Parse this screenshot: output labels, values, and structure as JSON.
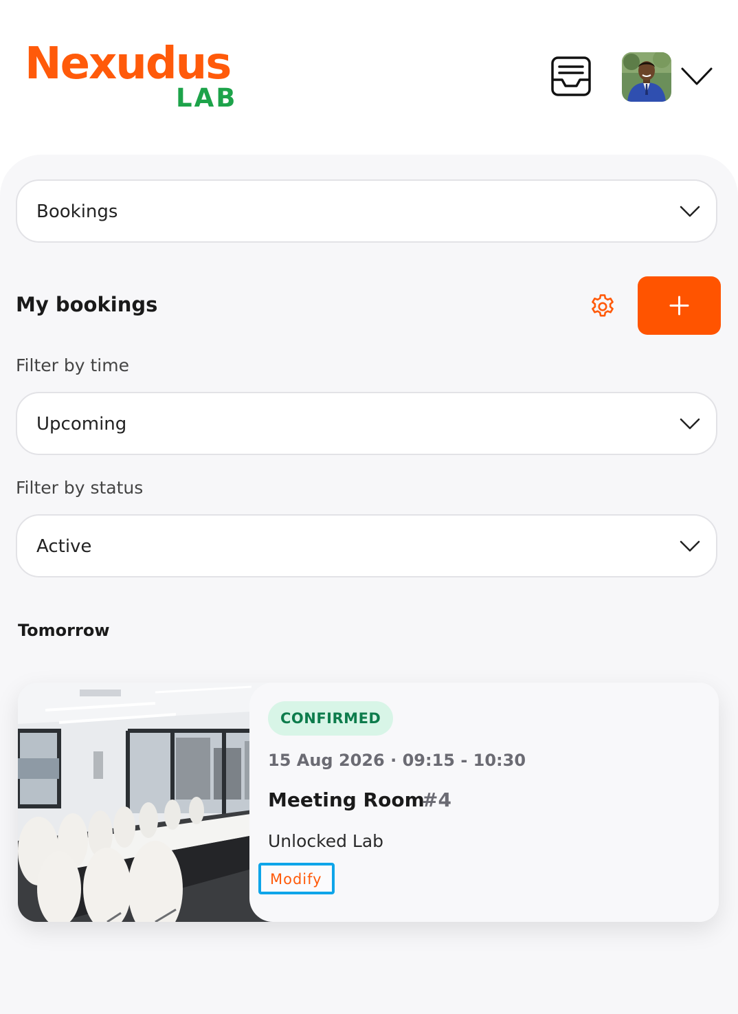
{
  "colors": {
    "brand_orange": "#ff5400",
    "brand_green": "#1da34a",
    "confirmed_bg": "#d8f5e7",
    "confirmed_text": "#0d7c4c",
    "highlight_border": "#0ea5e9"
  },
  "header": {
    "logo_main": "Nexudus",
    "logo_sub": "LAB",
    "inbox_icon": "inbox-icon",
    "avatar_icon": "user-avatar",
    "menu_icon": "chevron-down-icon"
  },
  "section_select": {
    "value": "Bookings"
  },
  "my_bookings": {
    "title": "My bookings",
    "settings_icon": "gear-icon",
    "add_icon": "plus-icon"
  },
  "filters": {
    "time_label": "Filter by time",
    "time_value": "Upcoming",
    "status_label": "Filter by status",
    "status_value": "Active"
  },
  "bookings_group": {
    "title": "Tomorrow",
    "items": [
      {
        "status": "CONFIRMED",
        "datetime": "15 Aug 2026 · 09:15 - 10:30",
        "resource": "Meeting Room",
        "number": "#4",
        "location": "Unlocked Lab",
        "action": "Modify",
        "image_icon": "meeting-room-photo"
      }
    ]
  }
}
